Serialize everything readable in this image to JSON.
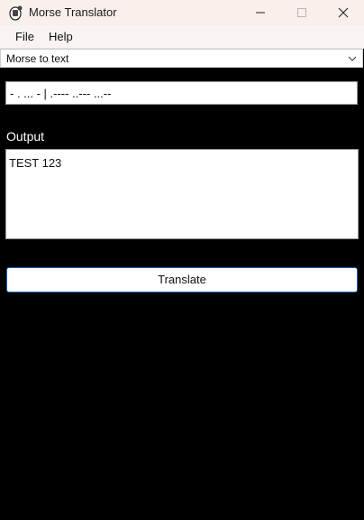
{
  "window": {
    "title": "Morse Translator",
    "icon": "app-icon"
  },
  "menu": {
    "items": [
      {
        "label": "File"
      },
      {
        "label": "Help"
      }
    ]
  },
  "mode_select": {
    "value": "Morse to text"
  },
  "input": {
    "value": "- . ... - | .---- ..--- ...--"
  },
  "output": {
    "label": "Output",
    "value": "TEST 123"
  },
  "actions": {
    "translate_label": "Translate"
  },
  "colors": {
    "background": "#000000",
    "titlebar": "#f9efeb",
    "accent": "#0067c0"
  }
}
